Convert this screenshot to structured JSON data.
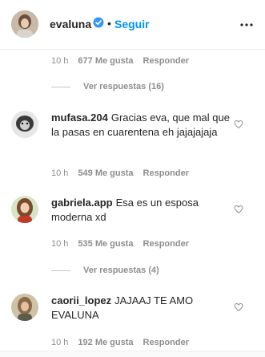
{
  "header": {
    "username": "evaluna",
    "dot": "•",
    "follow_label": "Seguir"
  },
  "first_comment_meta": {
    "time": "10 h",
    "likes": "677 Me gusta",
    "reply": "Responder"
  },
  "replies_1": {
    "label": "Ver respuestas (16)"
  },
  "comments": [
    {
      "user": "mufasa.204",
      "text": "Gracias eva, que mal que la pasas en cuarentena eh jajajajaja",
      "time": "10 h",
      "likes": "549 Me gusta",
      "reply": "Responder"
    },
    {
      "user": "gabriela.app",
      "text": "Esa es un esposa moderna xd",
      "time": "10 h",
      "likes": "535 Me gusta",
      "reply": "Responder"
    },
    {
      "user": "caorii_lopez",
      "text": "JAJAAJ TE AMO EVALUNA",
      "time": "10 h",
      "likes": "192 Me gusta",
      "reply": "Responder"
    }
  ],
  "replies_2": {
    "label": "Ver respuestas (4)"
  },
  "colors": {
    "link": "#0095f6",
    "muted": "#8e8e8e",
    "text": "#262626",
    "verified": "#3897f0"
  },
  "icons": [
    "verified-badge-icon",
    "more-options-icon",
    "heart-icon"
  ]
}
